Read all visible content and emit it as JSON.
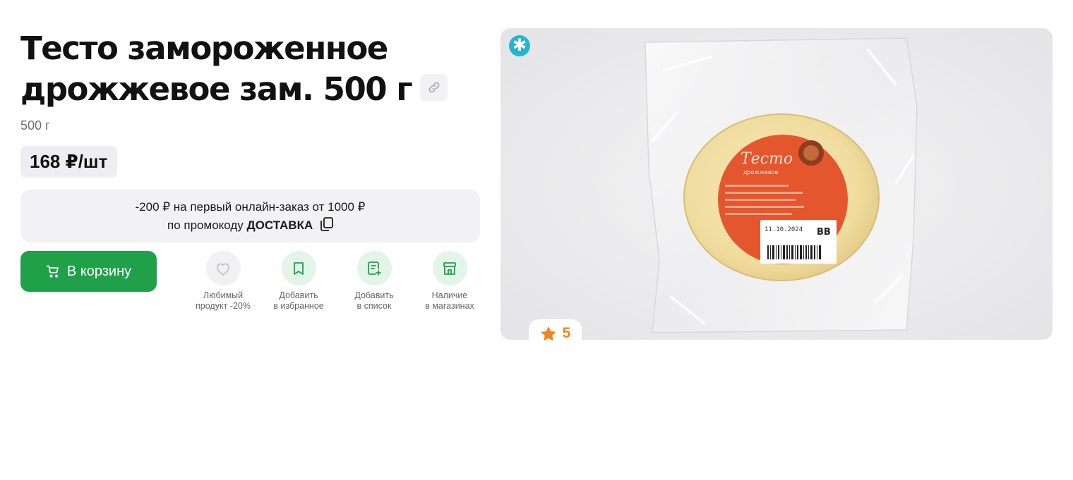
{
  "product": {
    "title_line1": "Тесто замороженное",
    "title_line2": "дрожжевое зам. 500 г",
    "weight": "500 г",
    "price": "168 ₽/шт"
  },
  "promo": {
    "line1": "-200 ₽ на первый онлайн-заказ от 1000 ₽",
    "line2_prefix": "по промокоду",
    "code": "ДОСТАВКА"
  },
  "cart": {
    "label": "В корзину"
  },
  "actions": [
    {
      "line1": "Любимый",
      "line2": "продукт -20%",
      "icon": "heart-icon"
    },
    {
      "line1": "Добавить",
      "line2": "в избранное",
      "icon": "bookmark-icon"
    },
    {
      "line1": "Добавить",
      "line2": "в список",
      "icon": "list-add-icon"
    },
    {
      "line1": "Наличие",
      "line2": "в магазинах",
      "icon": "store-icon"
    }
  ],
  "image": {
    "label_brand": "Тесто",
    "label_sub": "дрожжевое",
    "label_date": "11.10.2024",
    "label_logo": "ВВ"
  },
  "rating": {
    "value": "5"
  },
  "colors": {
    "accent_green": "#21a04a",
    "frozen_badge": "#27b4cf",
    "rating_orange": "#f0851f",
    "label_orange": "#e4572e"
  }
}
